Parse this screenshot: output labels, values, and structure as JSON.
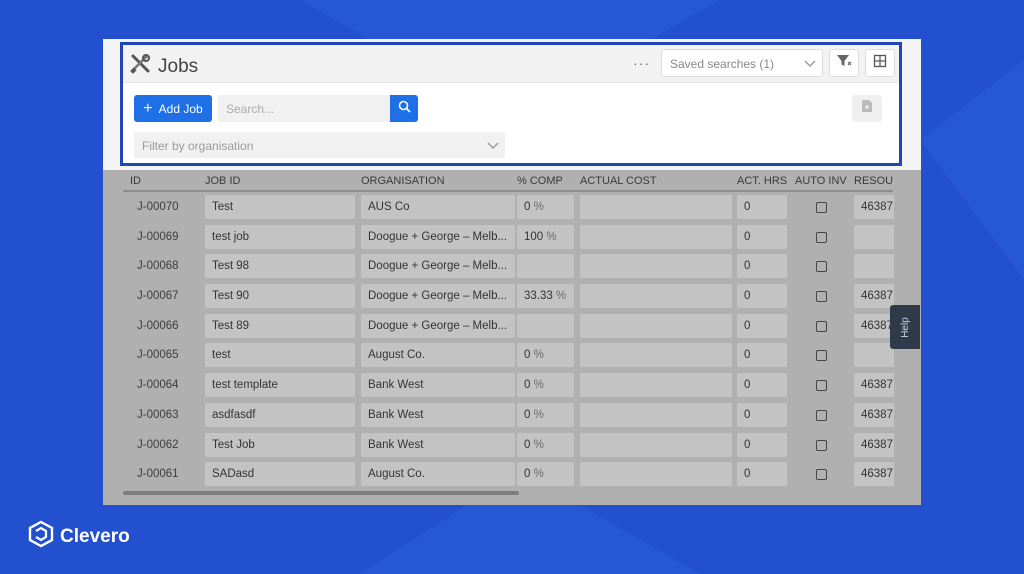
{
  "page": {
    "title": "Jobs",
    "more_label": "···",
    "saved_searches_label": "Saved searches (1)",
    "add_job_label": "Add Job",
    "search_placeholder": "Search...",
    "filter_org_placeholder": "Filter by organisation",
    "help_label": "Help"
  },
  "brand": {
    "name": "Clevero",
    "color": "#2350cf"
  },
  "accent_color": "#1f6fe6",
  "highlight_color": "#1f46b4",
  "table": {
    "columns": [
      "ID",
      "JOB ID",
      "ORGANISATION",
      "% COMP",
      "ACTUAL COST",
      "ACT. HRS",
      "AUTO INV",
      "RESOU"
    ],
    "rows": [
      {
        "id": "J-00070",
        "job": "Test",
        "org": "AUS Co",
        "comp": "0",
        "cost": "",
        "hrs": "0",
        "auto": false,
        "res": "46387"
      },
      {
        "id": "J-00069",
        "job": "test job",
        "org": "Doogue + George – Melb...",
        "comp": "100",
        "cost": "",
        "hrs": "0",
        "auto": false,
        "res": ""
      },
      {
        "id": "J-00068",
        "job": "Test 98",
        "org": "Doogue + George – Melb...",
        "comp": "",
        "cost": "",
        "hrs": "0",
        "auto": false,
        "res": ""
      },
      {
        "id": "J-00067",
        "job": "Test 90",
        "org": "Doogue + George – Melb...",
        "comp": "33.33",
        "cost": "",
        "hrs": "0",
        "auto": false,
        "res": "46387"
      },
      {
        "id": "J-00066",
        "job": "Test 89",
        "org": "Doogue + George – Melb...",
        "comp": "",
        "cost": "",
        "hrs": "0",
        "auto": false,
        "res": "46387"
      },
      {
        "id": "J-00065",
        "job": "test",
        "org": "August Co.",
        "comp": "0",
        "cost": "",
        "hrs": "0",
        "auto": false,
        "res": ""
      },
      {
        "id": "J-00064",
        "job": "test template",
        "org": "Bank West",
        "comp": "0",
        "cost": "",
        "hrs": "0",
        "auto": false,
        "res": "46387"
      },
      {
        "id": "J-00063",
        "job": "asdfasdf",
        "org": "Bank West",
        "comp": "0",
        "cost": "",
        "hrs": "0",
        "auto": false,
        "res": "46387"
      },
      {
        "id": "J-00062",
        "job": "Test Job",
        "org": "Bank West",
        "comp": "0",
        "cost": "",
        "hrs": "0",
        "auto": false,
        "res": "46387"
      },
      {
        "id": "J-00061",
        "job": "SADasd",
        "org": "August Co.",
        "comp": "0",
        "cost": "",
        "hrs": "0",
        "auto": false,
        "res": "46387"
      }
    ]
  }
}
